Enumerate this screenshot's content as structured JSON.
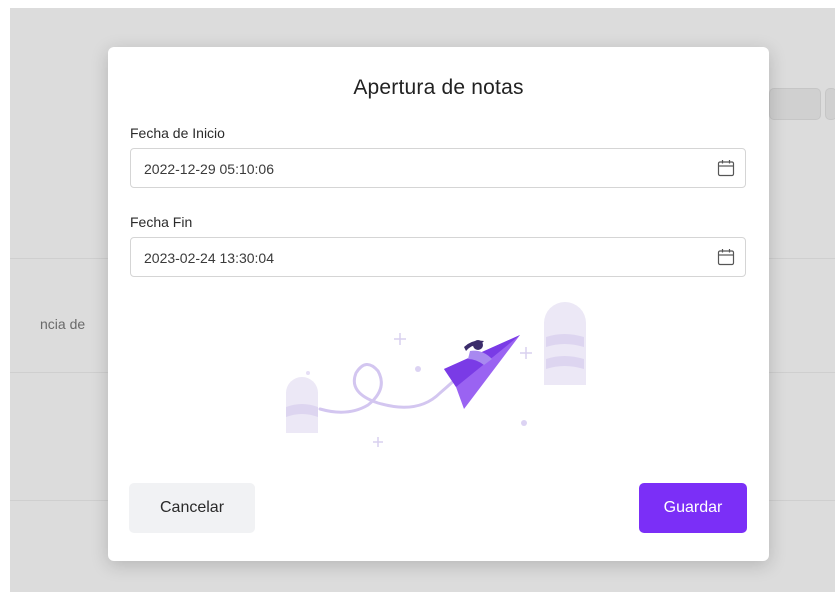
{
  "modal": {
    "title": "Apertura de notas",
    "start_label": "Fecha de Inicio",
    "start_value": "2022-12-29 05:10:06",
    "end_label": "Fecha Fin",
    "end_value": "2023-02-24 13:30:04",
    "cancel_label": "Cancelar",
    "save_label": "Guardar"
  },
  "background": {
    "fragment_text": "ncia de"
  },
  "colors": {
    "accent": "#7b2ff7",
    "overlay": "#dcdcdc",
    "cancel_bg": "#f1f2f4"
  },
  "icons": [
    "calendar-icon",
    "paper-plane-illustration"
  ]
}
